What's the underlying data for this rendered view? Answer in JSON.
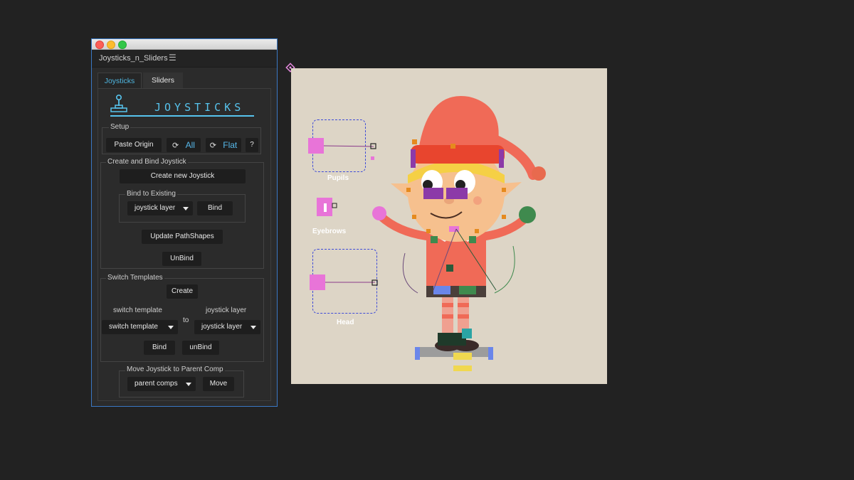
{
  "panel": {
    "title": "Joysticks_n_Sliders",
    "menu_icon": "hamburger-icon",
    "tabs": [
      {
        "label": "Joysticks",
        "active": true
      },
      {
        "label": "Sliders",
        "active": false
      }
    ],
    "header": {
      "title": "JOYSTICKS",
      "icon": "joystick-icon",
      "accent": "#57c4ee"
    },
    "setup": {
      "label": "Setup",
      "paste_origin": "Paste Origin",
      "all": "All",
      "flat": "Flat",
      "help": "?"
    },
    "create_bind": {
      "label": "Create and Bind Joystick",
      "create_new": "Create new Joystick",
      "bind_existing": {
        "label": "Bind to Existing",
        "dropdown": "joystick layer",
        "bind": "Bind"
      },
      "update_pathshapes": "Update PathShapes",
      "unbind": "UnBind"
    },
    "switch_templates": {
      "label": "Switch Templates",
      "create": "Create",
      "left_label": "switch template",
      "to": "to",
      "right_label": "joystick layer",
      "left_dropdown": "switch template",
      "right_dropdown": "joystick layer",
      "bind": "Bind",
      "unbind": "unBind"
    },
    "move_joystick": {
      "label": "Move Joystick to Parent Comp",
      "dropdown": "parent comps",
      "move": "Move"
    }
  },
  "composition": {
    "background": "#ddd5c6",
    "labels": {
      "pupils": "Pupils",
      "eyebrows": "Eyebrows",
      "head": "Head"
    },
    "character": "elf-character"
  }
}
